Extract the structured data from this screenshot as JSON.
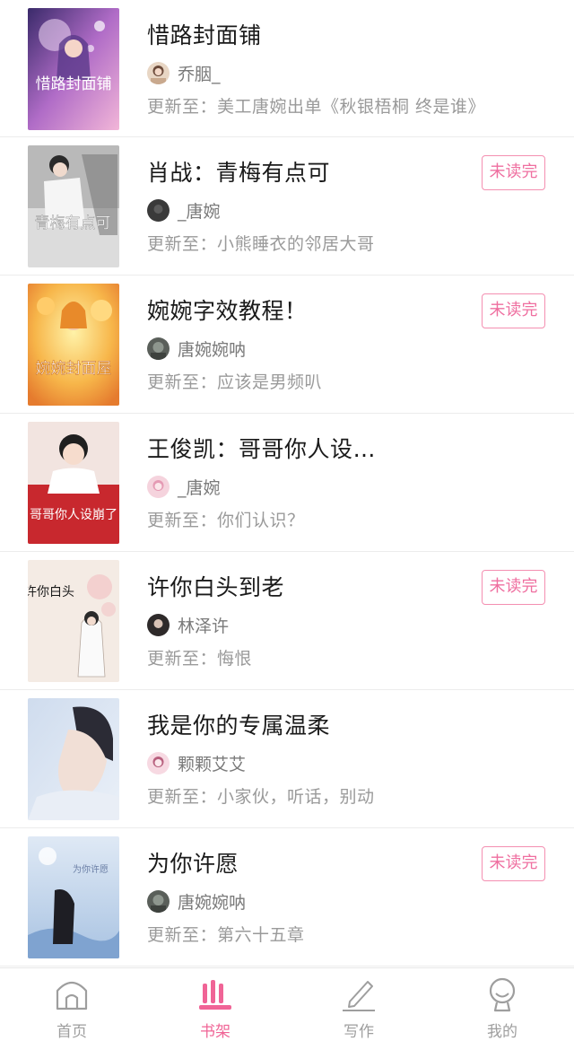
{
  "books": [
    {
      "title": "惜路封面铺",
      "author": "乔胭_",
      "update": "更新至：美工唐婉出单《秋银梧桐 终是谁》",
      "badge": ""
    },
    {
      "title": "肖战：青梅有点可",
      "author": "_唐婉",
      "update": "更新至：小熊睡衣的邻居大哥",
      "badge": "未读完"
    },
    {
      "title": "婉婉字效教程！",
      "author": "唐婉婉呐",
      "update": "更新至：应该是男频叭",
      "badge": "未读完"
    },
    {
      "title": "王俊凯：哥哥你人设…",
      "author": "_唐婉",
      "update": "更新至：你们认识？",
      "badge": ""
    },
    {
      "title": "许你白头到老",
      "author": "林泽许",
      "update": "更新至：悔恨",
      "badge": "未读完"
    },
    {
      "title": "我是你的专属温柔",
      "author": "颗颗艾艾",
      "update": "更新至：小家伙，听话，别动",
      "badge": ""
    },
    {
      "title": "为你许愿",
      "author": "唐婉婉呐",
      "update": "更新至：第六十五章",
      "badge": "未读完"
    }
  ],
  "covers": [
    {
      "text": "惜路封面铺"
    },
    {
      "text": "青梅有点可"
    },
    {
      "text": "婉婉封面屋"
    },
    {
      "text": "哥哥你人设崩了"
    },
    {
      "text": "许你白头"
    },
    {
      "text": ""
    },
    {
      "text": "为你许愿"
    }
  ],
  "tabbar": {
    "tabs": [
      {
        "label": "首页",
        "icon": "home-icon",
        "active": false
      },
      {
        "label": "书架",
        "icon": "bookshelf-icon",
        "active": true
      },
      {
        "label": "写作",
        "icon": "pencil-icon",
        "active": false
      },
      {
        "label": "我的",
        "icon": "profile-icon",
        "active": false
      }
    ]
  },
  "colors": {
    "accent": "#f06496",
    "badge_border": "#f48fb1",
    "text_primary": "#1a1a1a",
    "text_secondary": "#7a7a7a",
    "text_tertiary": "#9a9a9a",
    "divider": "#ececec"
  }
}
